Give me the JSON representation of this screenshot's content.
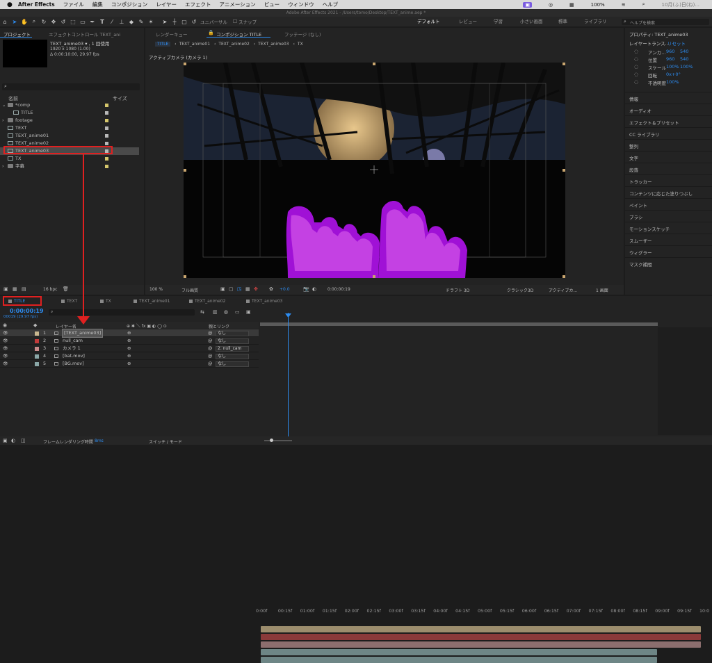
{
  "menubar": {
    "items": [
      "After Effects",
      "ファイル",
      "編集",
      "コンポジション",
      "レイヤー",
      "エフェクト",
      "アニメーション",
      "ビュー",
      "ウィンドウ",
      "ヘルプ"
    ],
    "battery": "100%",
    "date": "10月(ふ)日(ね)..."
  },
  "window_title": "Adobe After Effects 2021 - /Users/tomo/Desktop/TEXT_anime.aep *",
  "toolbar": {
    "snap_label": "スナップ",
    "universal_label": "ユニバーサル",
    "workspaces": [
      "デフォルト",
      "レビュー",
      "学習",
      "小さい画面",
      "標準",
      "ライブラリ"
    ],
    "search_placeholder": "ヘルプを検索"
  },
  "project": {
    "tab": "プロジェクト",
    "effects_tab": "エフェクトコントロール TEXT_ani",
    "item_name": "TEXT_anime03 ▾ , 1 回使用",
    "item_size": "1920 x 1080 (1.00)",
    "item_duration": "Δ 0:00:10:00, 29.97 fps",
    "col_name": "名前",
    "col_size": "サイズ",
    "bpc": "16 bpc",
    "rows": [
      {
        "label": "*comp",
        "type": "folder",
        "indent": 0,
        "color": "#d6c76c"
      },
      {
        "label": "TITLE",
        "type": "comp",
        "indent": 1,
        "color": "#b9b9b9"
      },
      {
        "label": "footage",
        "type": "folder",
        "indent": 0,
        "color": "#d6c76c"
      },
      {
        "label": "TEXT",
        "type": "comp",
        "indent": 0,
        "color": "#b9b9b9"
      },
      {
        "label": "TEXT_anime01",
        "type": "comp",
        "indent": 0,
        "color": "#b9b9b9"
      },
      {
        "label": "TEXT_anime02",
        "type": "comp",
        "indent": 0,
        "color": "#b9b9b9"
      },
      {
        "label": "TEXT_anime03",
        "type": "comp",
        "indent": 0,
        "color": "#b9b9b9"
      },
      {
        "label": "TX",
        "type": "comp",
        "indent": 0,
        "color": "#d6c76c"
      },
      {
        "label": "字幕",
        "type": "folder",
        "indent": 0,
        "color": "#d6c76c"
      }
    ]
  },
  "viewer": {
    "tabs": [
      "レンダーキュー",
      "コンポジション TITLE",
      "フッテージ (なし)"
    ],
    "breadcrumbs": [
      "TITLE",
      "TEXT_anime01",
      "TEXT_anime02",
      "TEXT_anime03",
      "TX"
    ],
    "camera_label": "アクティブカメラ (カメラ 1)",
    "zoom": "100 %",
    "quality": "フル画質",
    "exposure": "+0.0",
    "timecode": "0:00:00:19",
    "draft": "ドラフト 3D",
    "renderer": "クラシック3D",
    "camera_view": "アクティブカ...",
    "views": "1 画面"
  },
  "right_panel": {
    "header": "プロパティ: TEXT_anime03",
    "transform_label": "レイヤートランス...",
    "reset": "リセット",
    "props": [
      {
        "label": "アンカ...",
        "v1": "960",
        "v2": "540"
      },
      {
        "label": "位置",
        "v1": "960",
        "v2": "540"
      },
      {
        "label": "スケール",
        "v1": "100%",
        "v2": "100%"
      },
      {
        "label": "回転",
        "v1": "0x+0°",
        "v2": ""
      },
      {
        "label": "不透明度",
        "v1": "100%",
        "v2": ""
      }
    ],
    "panels": [
      "情報",
      "オーディオ",
      "エフェクト＆プリセット",
      "CC ライブラリ",
      "整列",
      "文字",
      "段落",
      "トラッカー",
      "コンテンツに応じた塗りつぶし",
      "ペイント",
      "ブラシ",
      "モーションスケッチ",
      "スムーザー",
      "ウィグラー",
      "マスク補間"
    ]
  },
  "timeline": {
    "tabs": [
      "TITLE",
      "TEXT",
      "TX",
      "TEXT_anime01",
      "TEXT_anime02",
      "TEXT_anime03"
    ],
    "timecode": "0:00:00:19",
    "fps": "00019 (29.97 fps)",
    "layer_name_header": "レイヤー名",
    "parent_header": "親とリンク",
    "rows": [
      {
        "num": "1",
        "name": "[TEXT_anime03]",
        "parent": "なし",
        "color": "#c8b78f",
        "bar": "#9c8d6d",
        "selected": true
      },
      {
        "num": "2",
        "name": "null_cam",
        "parent": "なし",
        "color": "#c23a3a",
        "bar": "#8a3a3a",
        "selected": false
      },
      {
        "num": "3",
        "name": "カメラ 1",
        "parent": "2. null_cam",
        "color": "#c98c8c",
        "bar": "#8c6e6e",
        "selected": false
      },
      {
        "num": "4",
        "name": "[bat.mov]",
        "parent": "なし",
        "color": "#8aa7a7",
        "bar": "#6e8686",
        "selected": false
      },
      {
        "num": "5",
        "name": "[BG.mov]",
        "parent": "なし",
        "color": "#8aa7a7",
        "bar": "#6e8686",
        "selected": false
      }
    ],
    "ruler": [
      "0:00f",
      "00:15f",
      "01:00f",
      "01:15f",
      "02:00f",
      "02:15f",
      "03:00f",
      "03:15f",
      "04:00f",
      "04:15f",
      "05:00f",
      "05:15f",
      "06:00f",
      "06:15f",
      "07:00f",
      "07:15f",
      "08:00f",
      "08:15f",
      "09:00f",
      "09:15f",
      "10:0"
    ],
    "footer_render": "フレームレンダリング時間",
    "footer_ms": "8ms",
    "footer_switch": "スイッチ / モード"
  },
  "colors": {
    "accent": "#2d8cf0",
    "highlight": "#e02020",
    "purple": "#a011d6"
  }
}
